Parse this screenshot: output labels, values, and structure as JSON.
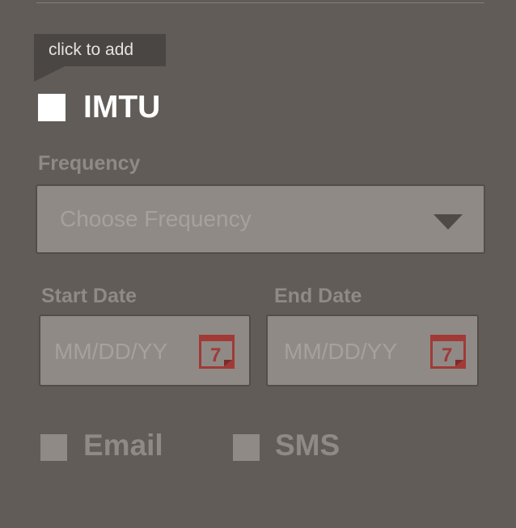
{
  "tooltip": {
    "text": "click to add"
  },
  "imtu": {
    "label": "IMTU",
    "checked": false
  },
  "frequency": {
    "label": "Frequency",
    "placeholder": "Choose Frequency"
  },
  "start_date": {
    "label": "Start Date",
    "placeholder": "MM/DD/YY",
    "calendar_icon_number": "7"
  },
  "end_date": {
    "label": "End Date",
    "placeholder": "MM/DD/YY",
    "calendar_icon_number": "7"
  },
  "notifications": {
    "email_label": "Email",
    "sms_label": "SMS"
  },
  "colors": {
    "background": "#615c58",
    "calendar_accent": "#a13a37",
    "tooltip_bg": "#4a4643"
  }
}
